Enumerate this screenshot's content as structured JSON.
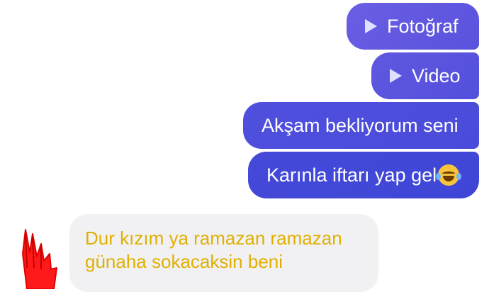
{
  "messages": {
    "outgoing": [
      {
        "type": "photo",
        "label": "Fotoğraf"
      },
      {
        "type": "video",
        "label": "Video"
      },
      {
        "type": "text",
        "label": "Akşam bekliyorum seni"
      },
      {
        "type": "text",
        "label": "Karınla iftarı yap gel"
      }
    ],
    "incoming": {
      "line1": "Dur kızım ya ramazan ramazan",
      "line2": "günaha sokacaksin beni"
    }
  },
  "icons": {
    "media_play": "play-icon",
    "emoji": "tears-of-joy-emoji",
    "annotation": "red-hand-scribble"
  },
  "colors": {
    "outgoing_bubble": "#4f50dd",
    "incoming_bubble": "#f1f1f3",
    "incoming_text": "#e0b000",
    "annotation": "#ff1a1a"
  }
}
